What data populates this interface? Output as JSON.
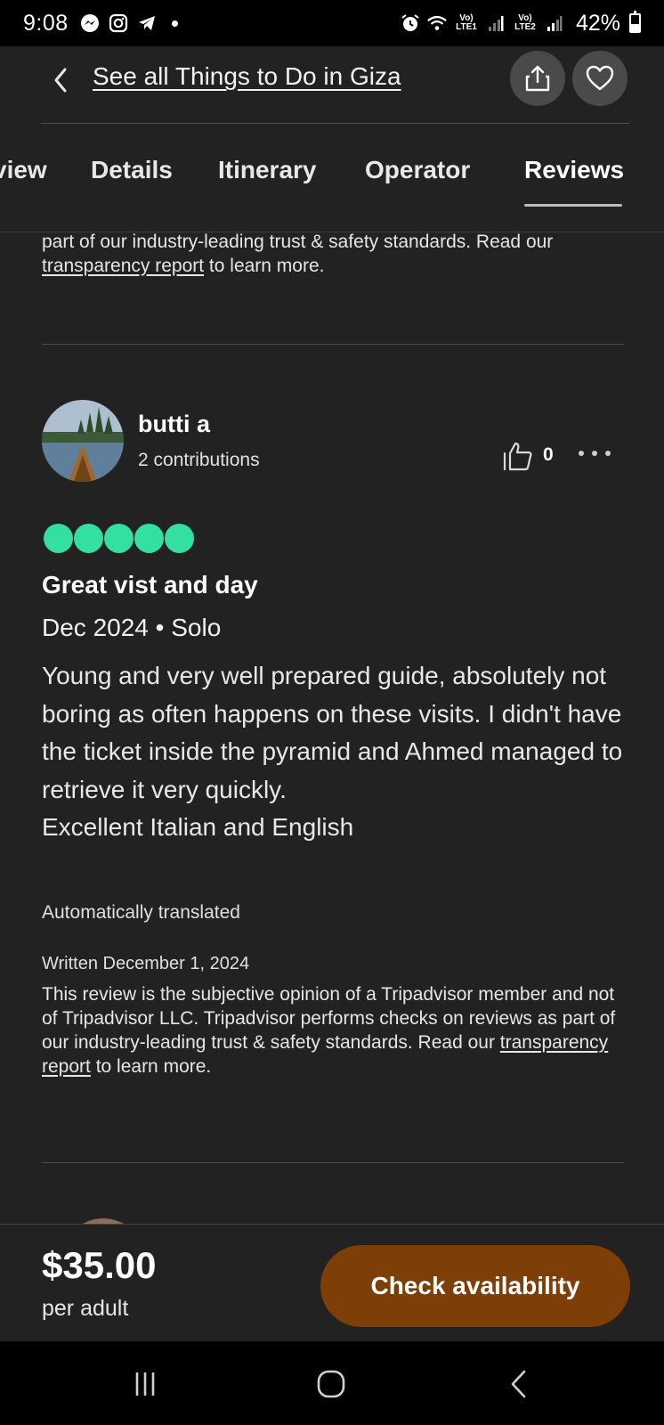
{
  "status_bar": {
    "time": "9:08",
    "network_1": "Vo) LTE1",
    "network_2": "Vo) LTE2",
    "battery_percent": "42%",
    "battery_level": 0.42,
    "left_icons": [
      "messenger-icon",
      "instagram-icon",
      "telegram-icon"
    ]
  },
  "header": {
    "title": "See all Things to Do in Giza",
    "back_icon": "chevron-left-icon",
    "share_icon": "share-icon",
    "save_icon": "heart-icon"
  },
  "tabs": {
    "items": [
      "view",
      "Details",
      "Itinerary",
      "Operator",
      "Reviews"
    ],
    "active": "Reviews"
  },
  "previous_review": {
    "disclaimer_before": "and not of Tripadvisor LLC. Tripadvisor performs checks on reviews as part of our industry-leading trust & safety standards. Read our ",
    "disclaimer_link": "transparency report",
    "disclaimer_after": " to learn more."
  },
  "review": {
    "reviewer_name": "butti a",
    "contributions": "2 contributions",
    "helpful_count": "0",
    "rating": 5,
    "rating_max": 5,
    "rating_color": "#34e0a1",
    "title": "Great vist and day",
    "meta": "Dec 2024 • Solo",
    "body": "Young and very well prepared guide, absolutely not boring as often happens on these visits. I didn't have the ticket inside the pyramid and Ahmed managed to retrieve it very quickly.\nExcellent Italian and English",
    "auto_translated": "Automatically translated",
    "written_date": "Written December 1, 2024",
    "disclaimer_before": "This review is the subjective opinion of a Tripadvisor member and not of Tripadvisor LLC. Tripadvisor performs checks on reviews as part of our industry-leading trust & safety standards. Read our ",
    "disclaimer_link": "transparency report",
    "disclaimer_after": " to learn more."
  },
  "booking": {
    "price": "$35.00",
    "price_unit": "per adult",
    "cta_label": "Check availability",
    "cta_color": "#7d3f07"
  },
  "nav_bar": {
    "recents_icon": "recents-icon",
    "home_icon": "home-icon",
    "back_icon": "back-icon"
  }
}
